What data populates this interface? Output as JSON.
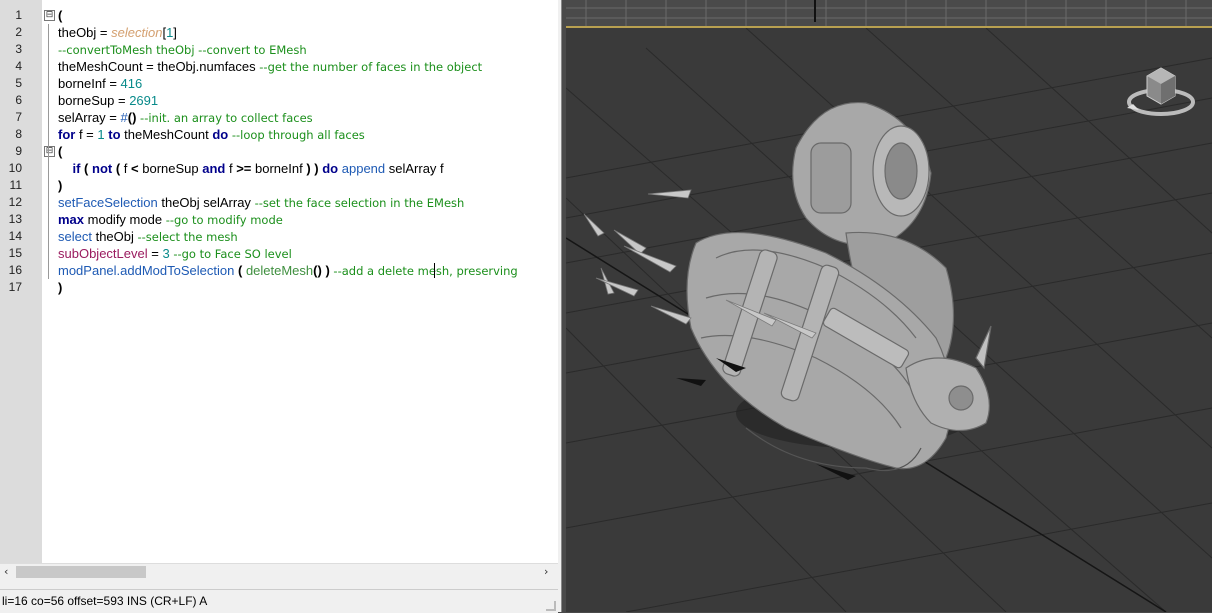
{
  "editor": {
    "line_numbers": [
      "1",
      "2",
      "3",
      "4",
      "5",
      "6",
      "7",
      "8",
      "9",
      "10",
      "11",
      "12",
      "13",
      "14",
      "15",
      "16",
      "17"
    ],
    "fold_symbol": "⊟",
    "lines": [
      {
        "tokens": [
          {
            "t": "(",
            "c": "br"
          }
        ]
      },
      {
        "tokens": [
          {
            "t": "theObj = ",
            "c": "bl"
          },
          {
            "t": "selection",
            "c": "sel"
          },
          {
            "t": "[",
            "c": "bl"
          },
          {
            "t": "1",
            "c": "num"
          },
          {
            "t": "]",
            "c": "bl"
          }
        ]
      },
      {
        "tokens": [
          {
            "t": "--convertToMesh theObj --convert to EMesh",
            "c": "cm"
          }
        ]
      },
      {
        "tokens": [
          {
            "t": "theMeshCount = theObj.numfaces ",
            "c": "bl"
          },
          {
            "t": "--get the number of faces in the object",
            "c": "cm"
          }
        ]
      },
      {
        "tokens": [
          {
            "t": "borneInf = ",
            "c": "bl"
          },
          {
            "t": "416",
            "c": "num"
          }
        ]
      },
      {
        "tokens": [
          {
            "t": "borneSup = ",
            "c": "bl"
          },
          {
            "t": "2691",
            "c": "num"
          }
        ]
      },
      {
        "tokens": [
          {
            "t": "selArray = ",
            "c": "bl"
          },
          {
            "t": "#",
            "c": "fn"
          },
          {
            "t": "()",
            "c": "br"
          },
          {
            "t": " --init. an array to collect faces",
            "c": "cm"
          }
        ]
      },
      {
        "tokens": [
          {
            "t": "for",
            "c": "kw"
          },
          {
            "t": " f = ",
            "c": "bl"
          },
          {
            "t": "1",
            "c": "num"
          },
          {
            "t": " ",
            "c": "bl"
          },
          {
            "t": "to",
            "c": "kw"
          },
          {
            "t": " theMeshCount ",
            "c": "bl"
          },
          {
            "t": "do",
            "c": "kw"
          },
          {
            "t": " --loop through all faces",
            "c": "cm"
          }
        ]
      },
      {
        "tokens": [
          {
            "t": "(",
            "c": "br"
          }
        ]
      },
      {
        "tokens": [
          {
            "t": "    ",
            "c": "bl"
          },
          {
            "t": "if",
            "c": "kw"
          },
          {
            "t": " ",
            "c": "bl"
          },
          {
            "t": "(",
            "c": "br"
          },
          {
            "t": " ",
            "c": "bl"
          },
          {
            "t": "not",
            "c": "kw"
          },
          {
            "t": " ",
            "c": "bl"
          },
          {
            "t": "(",
            "c": "br"
          },
          {
            "t": " f ",
            "c": "bl"
          },
          {
            "t": "<",
            "c": "br"
          },
          {
            "t": " borneSup ",
            "c": "bl"
          },
          {
            "t": "and",
            "c": "kw"
          },
          {
            "t": " f ",
            "c": "bl"
          },
          {
            "t": ">=",
            "c": "br"
          },
          {
            "t": " borneInf ",
            "c": "bl"
          },
          {
            "t": ") )",
            "c": "br"
          },
          {
            "t": " ",
            "c": "bl"
          },
          {
            "t": "do",
            "c": "kw"
          },
          {
            "t": " ",
            "c": "bl"
          },
          {
            "t": "append",
            "c": "fn"
          },
          {
            "t": " selArray f",
            "c": "bl"
          }
        ]
      },
      {
        "tokens": [
          {
            "t": ")",
            "c": "br"
          }
        ]
      },
      {
        "tokens": [
          {
            "t": "setFaceSelection",
            "c": "fn"
          },
          {
            "t": " theObj selArray ",
            "c": "bl"
          },
          {
            "t": "--set the face selection in the EMesh",
            "c": "cm"
          }
        ]
      },
      {
        "tokens": [
          {
            "t": "max",
            "c": "mx"
          },
          {
            "t": " modify mode ",
            "c": "bl"
          },
          {
            "t": "--go to modify mode",
            "c": "cm"
          }
        ]
      },
      {
        "tokens": [
          {
            "t": "select",
            "c": "fn"
          },
          {
            "t": " theObj ",
            "c": "bl"
          },
          {
            "t": "--select the mesh",
            "c": "cm"
          }
        ]
      },
      {
        "tokens": [
          {
            "t": "subObjectLevel",
            "c": "ol"
          },
          {
            "t": " = ",
            "c": "bl"
          },
          {
            "t": "3",
            "c": "num"
          },
          {
            "t": " ",
            "c": "bl"
          },
          {
            "t": "--go to Face SO level",
            "c": "cm"
          }
        ]
      },
      {
        "tokens": [
          {
            "t": "modPanel.addModToSelection",
            "c": "fn"
          },
          {
            "t": " ",
            "c": "bl"
          },
          {
            "t": "(",
            "c": "br"
          },
          {
            "t": " ",
            "c": "bl"
          },
          {
            "t": "deleteMesh",
            "c": "dm"
          },
          {
            "t": "()",
            "c": "br"
          },
          {
            "t": " ",
            "c": "bl"
          },
          {
            "t": ")",
            "c": "br"
          },
          {
            "t": " ",
            "c": "bl"
          },
          {
            "t": "--add a delete mesh, preserving",
            "c": "cm"
          }
        ]
      },
      {
        "tokens": [
          {
            "t": ")",
            "c": "br"
          }
        ]
      }
    ]
  },
  "scrollbar": {
    "left_arrow": "‹",
    "right_arrow": "›"
  },
  "status": {
    "text": "li=16 co=56 offset=593 INS (CR+LF) A"
  },
  "colors": {
    "viewport_bg": "#3a3a3a",
    "viewport_border": "#b8a050",
    "model": "#a8a8a8"
  },
  "viewport": {
    "viewcube_icon": "viewcube-icon",
    "model_icon": "3d-model"
  }
}
